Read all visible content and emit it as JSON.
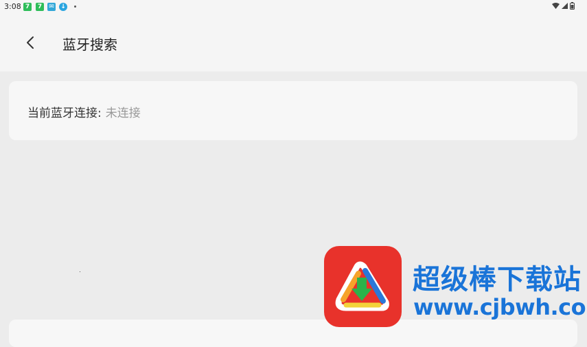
{
  "status_bar": {
    "time": "3:08",
    "notifications": [
      "seven-app-icon",
      "seven-app-icon",
      "chat-app-icon",
      "download-icon"
    ],
    "icons_right": [
      "wifi-icon",
      "signal-icon",
      "battery-icon"
    ]
  },
  "header": {
    "title": "蓝牙搜索",
    "back_icon": "chevron-left-icon"
  },
  "connection": {
    "label": "当前蓝牙连接:",
    "value": "未连接"
  },
  "watermark": {
    "brand": "超级棒下载站",
    "url": "www.cjbwh.com"
  },
  "colors": {
    "background": "#ececec",
    "card": "#f7f7f7",
    "title_text": "#222222",
    "muted_text": "#999999",
    "watermark_blue": "#1a74d8",
    "logo_red": "#e8322b"
  }
}
